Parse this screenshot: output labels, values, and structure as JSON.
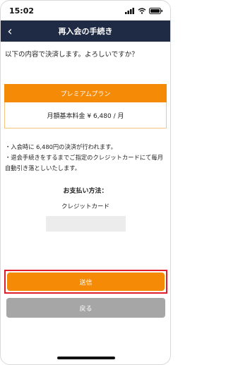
{
  "status_bar": {
    "time": "15:02"
  },
  "nav": {
    "title": "再入会の手続き",
    "back_glyph": "‹"
  },
  "content": {
    "confirm_text": "以下の内容で決済します。よろしいですか？",
    "plan": {
      "name": "プレミアムプラン",
      "price_text": "月額基本料金 ¥ 6,480 / 月"
    },
    "notes": [
      "・入会時に 6,480円の決済が行われます。",
      "・退会手続きをするまでご指定のクレジットカードにて毎月自動引き落としいたします。"
    ],
    "payment": {
      "title": "お支払い方法：",
      "method": "クレジットカード"
    }
  },
  "actions": {
    "send_label": "送信",
    "back_label": "戻る"
  },
  "colors": {
    "nav_bg": "#1f2a44",
    "accent_orange": "#f58a07",
    "highlight_red": "#e01e2b",
    "back_gray": "#a6a6a6"
  }
}
